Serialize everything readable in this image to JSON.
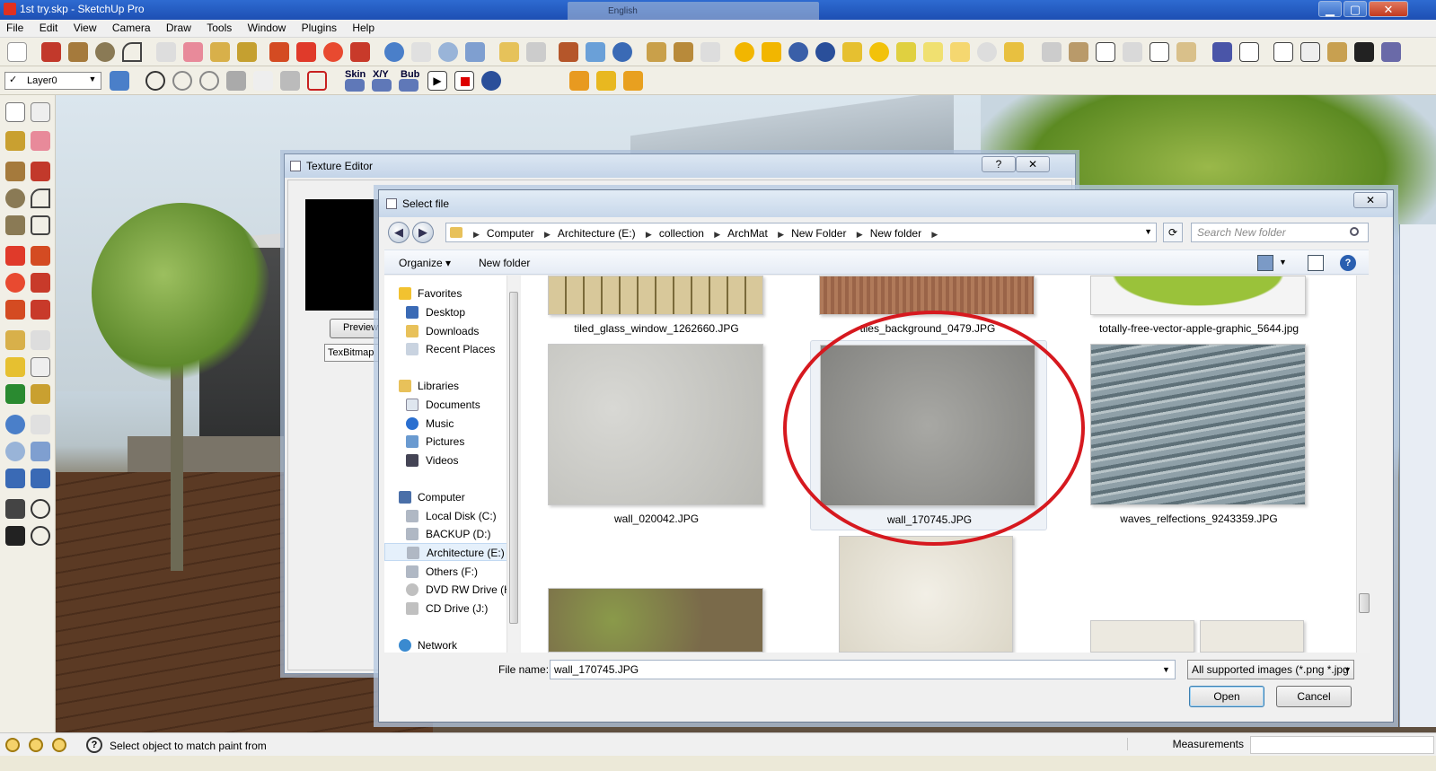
{
  "window": {
    "title": "1st try.skp - SketchUp Pro",
    "language": "English",
    "minimize": "▁",
    "maximize": "▢",
    "close": "✕"
  },
  "menu": [
    "File",
    "Edit",
    "View",
    "Camera",
    "Draw",
    "Tools",
    "Window",
    "Plugins",
    "Help"
  ],
  "toolbar": {
    "layer": "Layer0",
    "layer_check": "✓",
    "plugin_labels": [
      "Skin",
      "X/Y",
      "Bub"
    ]
  },
  "texture_editor": {
    "title": "Texture Editor",
    "help": "?",
    "close": "✕",
    "preview_label": "Preview",
    "texbitmap_label": "TexBitmap"
  },
  "select_file": {
    "title": "Select file",
    "close": "✕",
    "breadcrumbs": [
      "Computer",
      "Architecture (E:)",
      "collection",
      "ArchMat",
      "New Folder",
      "New folder"
    ],
    "search_placeholder": "Search New folder",
    "organize": "Organize ▾",
    "new_folder": "New folder",
    "nav": {
      "favorites": "Favorites",
      "favorites_items": [
        "Desktop",
        "Downloads",
        "Recent Places"
      ],
      "libraries": "Libraries",
      "libraries_items": [
        "Documents",
        "Music",
        "Pictures",
        "Videos"
      ],
      "computer": "Computer",
      "computer_items": [
        "Local Disk (C:)",
        "BACKUP (D:)",
        "Architecture (E:)",
        "Others (F:)",
        "DVD RW Drive (H",
        "CD Drive (J:)"
      ],
      "network": "Network"
    },
    "files": [
      "tiled_glass_window_1262660.JPG",
      "tiles_background_0479.JPG",
      "totally-free-vector-apple-graphic_5644.jpg",
      "wall_020042.JPG",
      "wall_170745.JPG",
      "waves_relfections_9243359.JPG"
    ],
    "file_name_label": "File name:",
    "file_name_value": "wall_170745.JPG",
    "file_type": "All supported images (*.png *.jpg",
    "open": "Open",
    "cancel": "Cancel"
  },
  "status": {
    "help_icon": "?",
    "text": "Select object to match paint from",
    "measurements": "Measurements"
  }
}
